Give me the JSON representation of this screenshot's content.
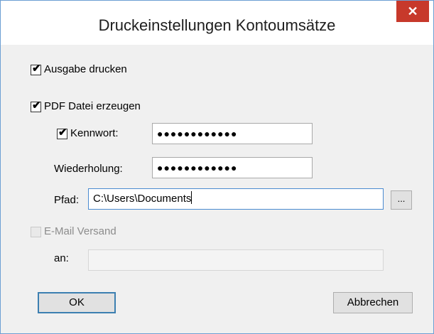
{
  "window": {
    "title": "Druckeinstellungen Kontoumsätze",
    "close_glyph": "✕"
  },
  "options": {
    "print_output": {
      "label": "Ausgabe drucken",
      "checked": true
    },
    "create_pdf": {
      "label": "PDF Datei erzeugen",
      "checked": true
    },
    "password": {
      "label": "Kennwort:",
      "checked": true,
      "value": "●●●●●●●●●●●●"
    },
    "repeat": {
      "label": "Wiederholung:",
      "value": "●●●●●●●●●●●●"
    },
    "path": {
      "label": "Pfad:",
      "value": "C:\\Users\\Documents",
      "browse_label": "..."
    },
    "email": {
      "label": "E-Mail Versand",
      "checked": false,
      "enabled": false
    },
    "recipient": {
      "label": "an:",
      "value": ""
    }
  },
  "buttons": {
    "ok": "OK",
    "cancel": "Abbrechen"
  },
  "check_glyph": "✔"
}
